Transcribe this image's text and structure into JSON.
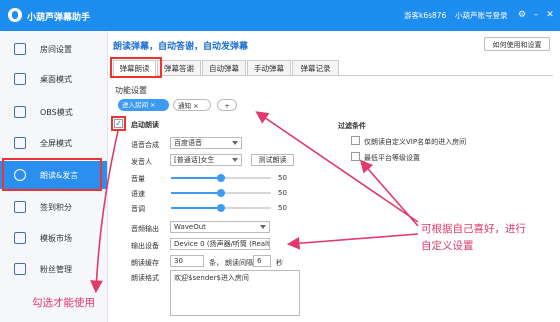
{
  "app": {
    "title": "小葫芦弹幕助手",
    "guest_label": "游客k6s876",
    "login_label": "小葫芦账号登录",
    "window_buttons": [
      "⚙",
      "–",
      "✕"
    ]
  },
  "sidebar": {
    "items": [
      {
        "label": "房间设置",
        "icon": "home-icon"
      },
      {
        "label": "桌面模式",
        "icon": "desktop-icon"
      },
      {
        "label": "OBS模式",
        "icon": "obs-icon"
      },
      {
        "label": "全屏模式",
        "icon": "fullscreen-icon"
      },
      {
        "label": "朗读&发言",
        "icon": "microphone-icon",
        "active": true
      },
      {
        "label": "签到积分",
        "icon": "calendar-icon"
      },
      {
        "label": "模板市场",
        "icon": "template-icon"
      },
      {
        "label": "粉丝管理",
        "icon": "fans-icon"
      }
    ]
  },
  "main": {
    "header": "朗读弹幕，自动答谢，自动发弹幕",
    "help_button": "如何使用和设置",
    "tabs": [
      "弹幕朗读",
      "弹幕答谢",
      "自动弹幕",
      "手动弹幕",
      "弹幕记录"
    ],
    "section_title": "功能设置",
    "tags": [
      "进入房间",
      "通知"
    ],
    "tag_add": "+",
    "enable_label": "启动朗读",
    "voice_engine_label": "语音合成",
    "voice_engine_value": "百度语音",
    "speaker_label": "发音人",
    "speaker_value": "[普通话]女生",
    "test_button": "测试朗读",
    "volume_label": "音量",
    "volume_value": "50",
    "speed_label": "语速",
    "speed_value": "50",
    "pitch_label": "音调",
    "pitch_value": "50",
    "audio_output_label": "音频输出",
    "audio_output_value": "WaveOut",
    "output_device_label": "输出设备",
    "output_device_value": "Device 0 (扬声器/听筒 (Realte",
    "cache_label": "朗读缓存",
    "cache_value": "30",
    "cache_unit": "条，",
    "interval_label": "朗读间隔",
    "interval_value": "6",
    "interval_unit": "秒",
    "format_label": "朗读格式",
    "format_value": "欢迎$sender$进入房间",
    "filter_title": "过滤条件",
    "filter_options": [
      "仅朗读自定义VIP名单的进入房间",
      "最低平台等级设置"
    ]
  },
  "annotations": {
    "right_note_line1": "可根据自己喜好，进行",
    "right_note_line2": "自定义设置",
    "bottom_note": "勾选才能使用"
  },
  "colors": {
    "title_bar": "#1d8ef0",
    "active_nav": "#2b8ff0",
    "annotation": "#e03a6b",
    "highlight_box": "#e33333"
  },
  "slider_levels": {
    "volume": 0.5,
    "speed": 0.5,
    "pitch": 0.5
  }
}
